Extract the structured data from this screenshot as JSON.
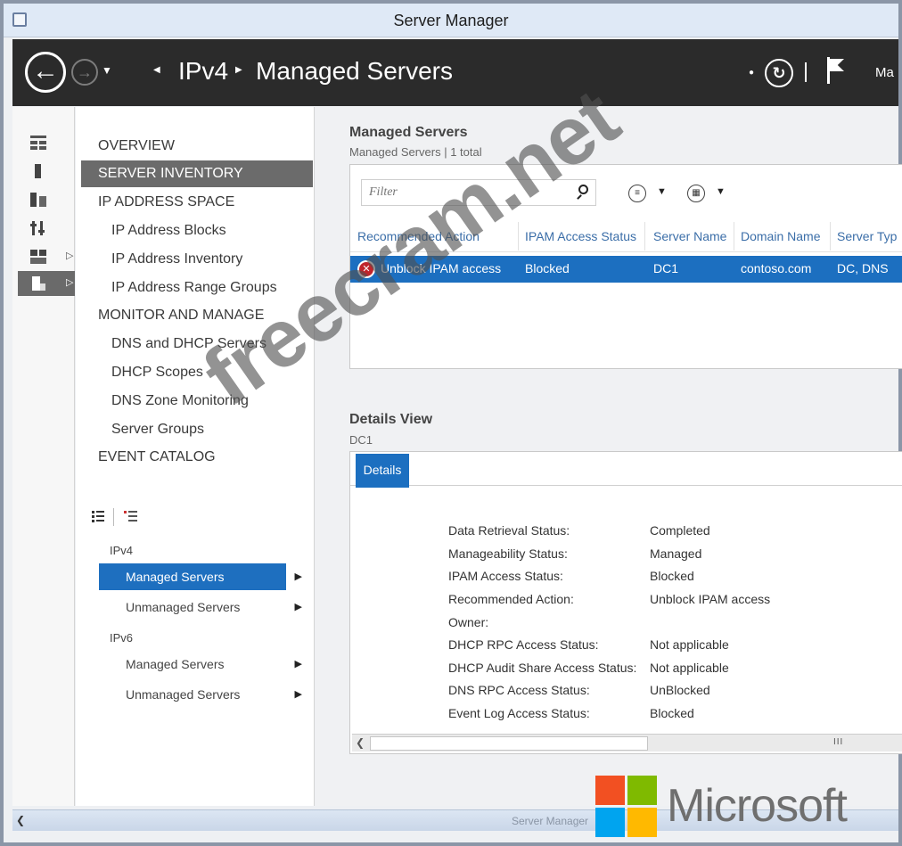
{
  "window": {
    "title": "Server Manager"
  },
  "header": {
    "breadcrumb": [
      "IPv4",
      "Managed Servers"
    ],
    "manage_label": "Ma"
  },
  "nav": {
    "items": [
      {
        "label": "OVERVIEW",
        "level": 0
      },
      {
        "label": "SERVER INVENTORY",
        "level": 0,
        "active": true
      },
      {
        "label": "IP ADDRESS SPACE",
        "level": 0
      },
      {
        "label": "IP Address Blocks",
        "level": 1
      },
      {
        "label": "IP Address Inventory",
        "level": 1
      },
      {
        "label": "IP Address Range Groups",
        "level": 1
      },
      {
        "label": "MONITOR AND MANAGE",
        "level": 0
      },
      {
        "label": "DNS and DHCP Servers",
        "level": 1
      },
      {
        "label": "DHCP Scopes",
        "level": 1
      },
      {
        "label": "DNS Zone Monitoring",
        "level": 1
      },
      {
        "label": "Server Groups",
        "level": 1
      },
      {
        "label": "EVENT CATALOG",
        "level": 0
      }
    ]
  },
  "tree": {
    "ipv4_label": "IPv4",
    "ipv4_items": [
      "Managed Servers",
      "Unmanaged Servers"
    ],
    "ipv6_label": "IPv6",
    "ipv6_items": [
      "Managed Servers",
      "Unmanaged Servers"
    ]
  },
  "managed": {
    "title": "Managed Servers",
    "subtitle": "Managed Servers | 1 total",
    "filter_placeholder": "Filter",
    "columns": [
      "Recommended Action",
      "IPAM Access Status",
      "Server Name",
      "Domain Name",
      "Server Typ"
    ],
    "rows": [
      {
        "action": "Unblock IPAM access",
        "status": "Blocked",
        "server": "DC1",
        "domain": "contoso.com",
        "type": "DC, DNS"
      }
    ]
  },
  "details": {
    "title": "Details View",
    "subtitle": "DC1",
    "tab_label": "Details",
    "fields": [
      {
        "k": "Data Retrieval Status:",
        "v": "Completed"
      },
      {
        "k": "Manageability Status:",
        "v": "Managed"
      },
      {
        "k": "IPAM Access Status:",
        "v": "Blocked"
      },
      {
        "k": "Recommended Action:",
        "v": "Unblock IPAM access"
      },
      {
        "k": "Owner:",
        "v": ""
      },
      {
        "k": "DHCP RPC Access Status:",
        "v": "Not applicable"
      },
      {
        "k": "DHCP Audit Share Access Status:",
        "v": "Not applicable"
      },
      {
        "k": "DNS RPC Access Status:",
        "v": "UnBlocked"
      },
      {
        "k": "Event Log Access Status:",
        "v": "Blocked"
      }
    ]
  },
  "bottom_bar": {
    "caption": "Server Manager"
  },
  "watermark": "freecram.net",
  "brand": {
    "name": "Microsoft",
    "colors": [
      "#f25022",
      "#7fba00",
      "#00a4ef",
      "#ffb900"
    ]
  },
  "theme": {
    "accent": "#1c6fc0",
    "header_bg": "#2b2b2b",
    "error": "#c0242b"
  }
}
